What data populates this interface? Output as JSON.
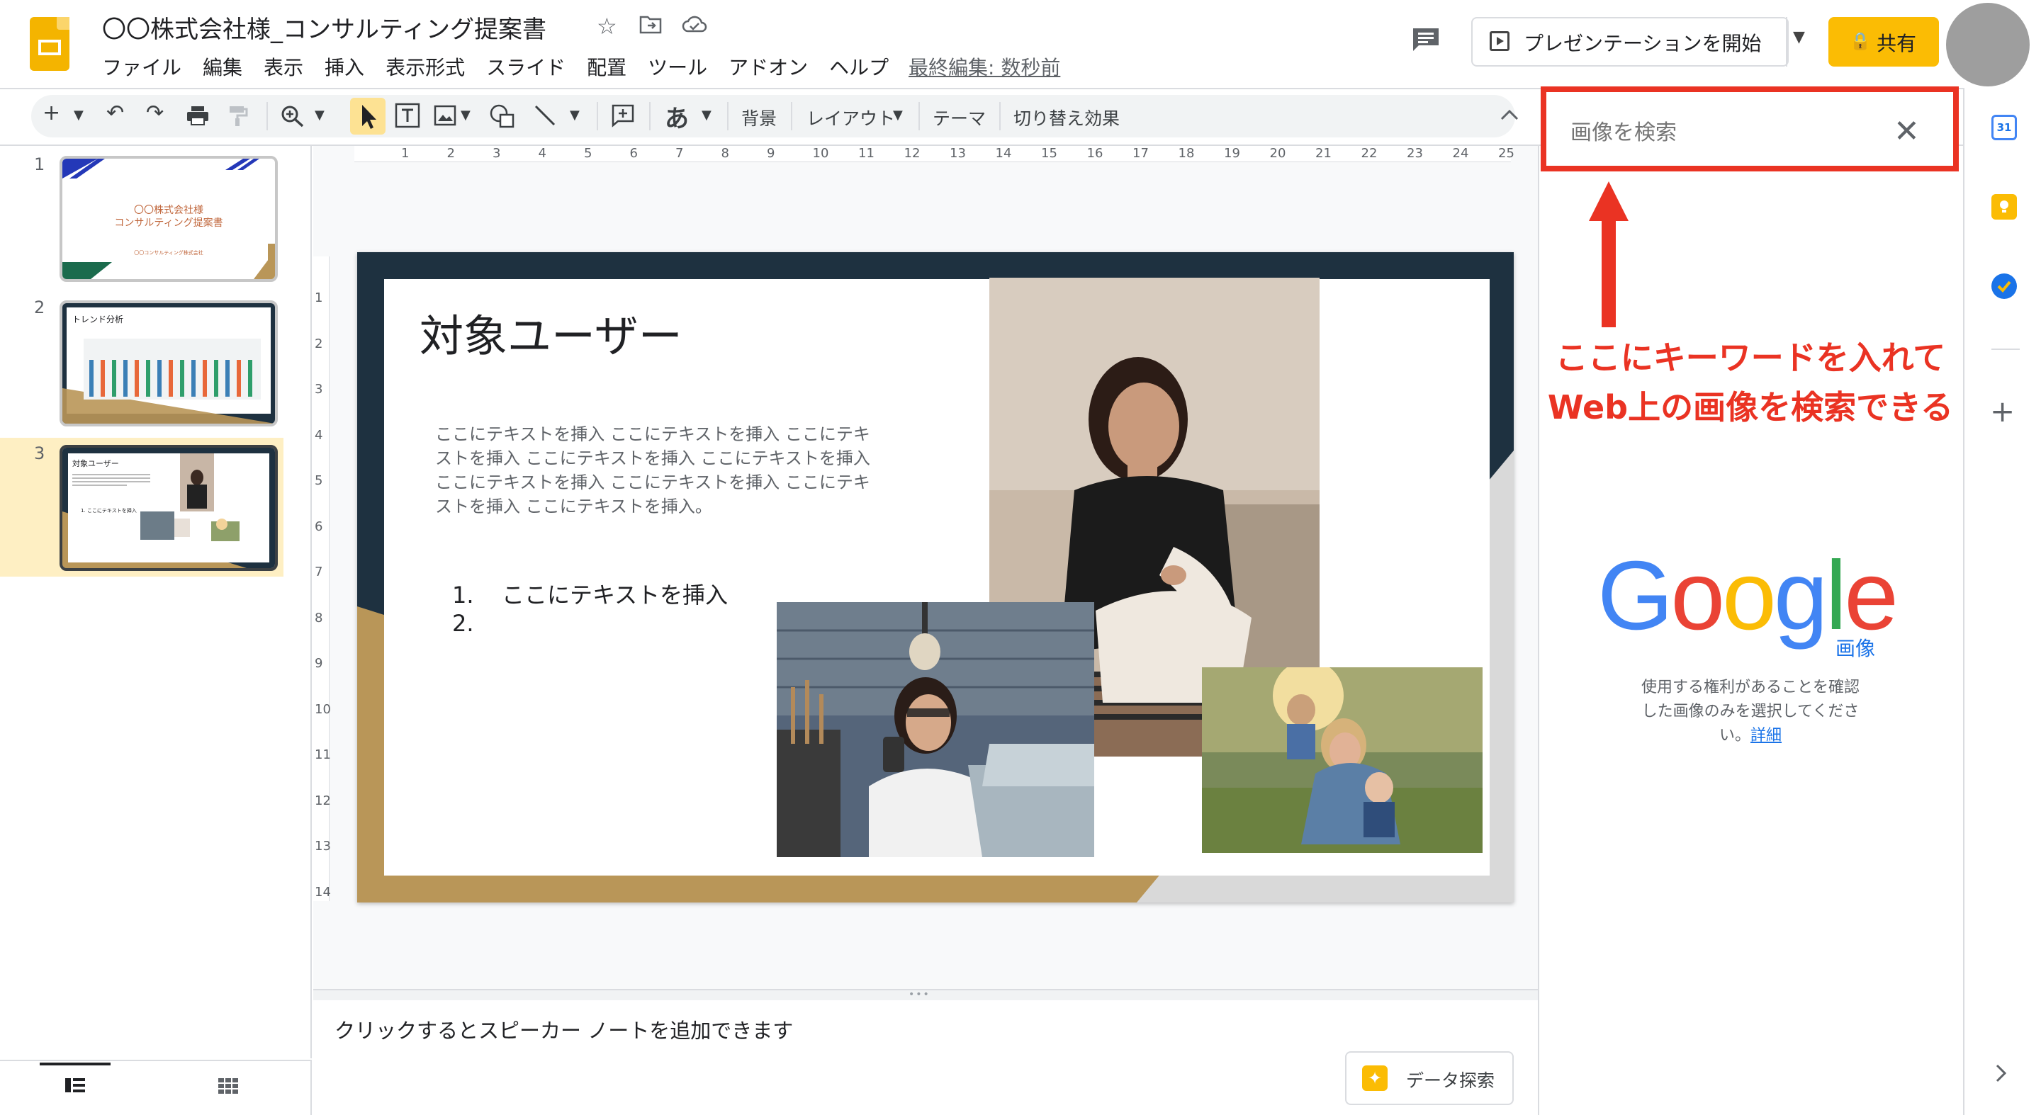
{
  "header": {
    "doc_title": "〇〇株式会社様_コンサルティング提案書",
    "menu": [
      "ファイル",
      "編集",
      "表示",
      "挿入",
      "表示形式",
      "スライド",
      "配置",
      "ツール",
      "アドオン",
      "ヘルプ"
    ],
    "last_edit": "最終編集: 数秒前",
    "present_label": "プレゼンテーションを開始",
    "share_label": "共有"
  },
  "toolbar": {
    "font_glyph": "あ",
    "background": "背景",
    "layout": "レイアウト",
    "theme": "テーマ",
    "transition": "切り替え効果"
  },
  "filmstrip": {
    "slides": [
      {
        "number": "1",
        "title": "〇〇株式会社様\nコンサルティング提案書",
        "sub": "〇〇コンサルティング株式会社"
      },
      {
        "number": "2",
        "title": "トレンド分析"
      },
      {
        "number": "3",
        "title": "対象ユーザー",
        "item": "1. ここにテキストを挿入"
      }
    ]
  },
  "slide": {
    "title": "対象ユーザー",
    "body": "ここにテキストを挿入 ここにテキストを挿入 ここにテキストを挿入 ここにテキストを挿入 ここにテキストを挿入 ここにテキストを挿入 ここにテキストを挿入 ここにテキストを挿入 ここにテキストを挿入。",
    "list": [
      "ここにテキストを挿入",
      ""
    ]
  },
  "notes": {
    "placeholder": "クリックするとスピーカー ノートを追加できます",
    "explore_label": "データ探索"
  },
  "image_search": {
    "placeholder": "画像を検索",
    "annotation_line1": "ここにキーワードを入れて",
    "annotation_line2": "Web上の画像を検索できる",
    "google_letters": [
      "G",
      "o",
      "o",
      "g",
      "l",
      "e"
    ],
    "google_sub": "画像",
    "rights_text": "使用する権利があることを確認した画像のみを選択してください。",
    "rights_link": "詳細"
  },
  "sidebar": {
    "calendar_number": "31"
  },
  "colors": {
    "accent_yellow": "#fbbc04",
    "annotation_red": "#ea3323",
    "slide_dark": "#1e3140",
    "slide_gold": "#b99658",
    "google_blue": "#4285f4",
    "google_red": "#ea4335",
    "google_yellow": "#fbbc05",
    "google_green": "#34a853"
  },
  "icons": [
    "slides-logo-icon",
    "star-icon",
    "move-folder-icon",
    "cloud-saved-icon",
    "comment-icon",
    "present-icon",
    "lock-icon",
    "add-icon",
    "undo-icon",
    "redo-icon",
    "print-icon",
    "paint-format-icon",
    "zoom-icon",
    "cursor-icon",
    "text-box-icon",
    "image-icon",
    "shape-icon",
    "line-icon",
    "add-comment-icon",
    "collapse-chevron-icon",
    "close-icon",
    "explore-icon",
    "calendar-icon",
    "keep-icon",
    "tasks-icon",
    "plus-icon",
    "expand-chevron-icon",
    "filmstrip-list-icon",
    "grid-view-icon"
  ]
}
